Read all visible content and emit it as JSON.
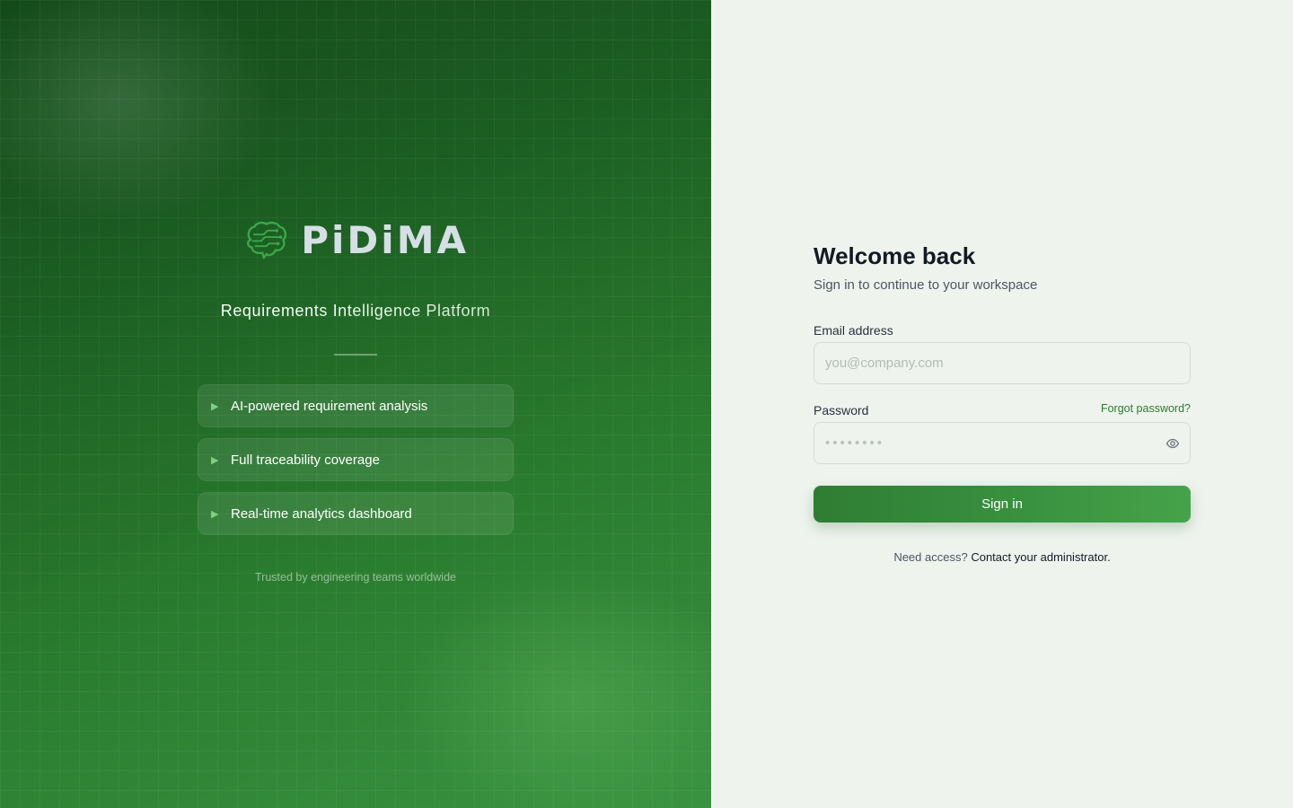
{
  "brand": {
    "logo_text": "PiDiMA",
    "tagline": "Requirements Intelligence Platform",
    "features": [
      {
        "icon": "play-arrow-icon",
        "label": "AI-powered requirement analysis"
      },
      {
        "icon": "play-arrow-icon",
        "label": "Full traceability coverage"
      },
      {
        "icon": "play-arrow-icon",
        "label": "Real-time analytics dashboard"
      }
    ],
    "trust_text": "Trusted by engineering teams worldwide"
  },
  "login": {
    "title": "Welcome back",
    "subtitle": "Sign in to continue to your workspace",
    "email_label": "Email address",
    "email_placeholder": "you@company.com",
    "email_value": "",
    "password_label": "Password",
    "password_placeholder": "••••••••",
    "password_value": "",
    "forgot_label": "Forgot password?",
    "show_password_icon": "eye-icon",
    "signin_label": "Sign in",
    "access_prefix": "Need access?",
    "access_link": "Contact your administrator."
  },
  "colors": {
    "brand_green": "#2a7d2f",
    "panel_bg": "#eef3ee",
    "title_color": "#141a24"
  }
}
